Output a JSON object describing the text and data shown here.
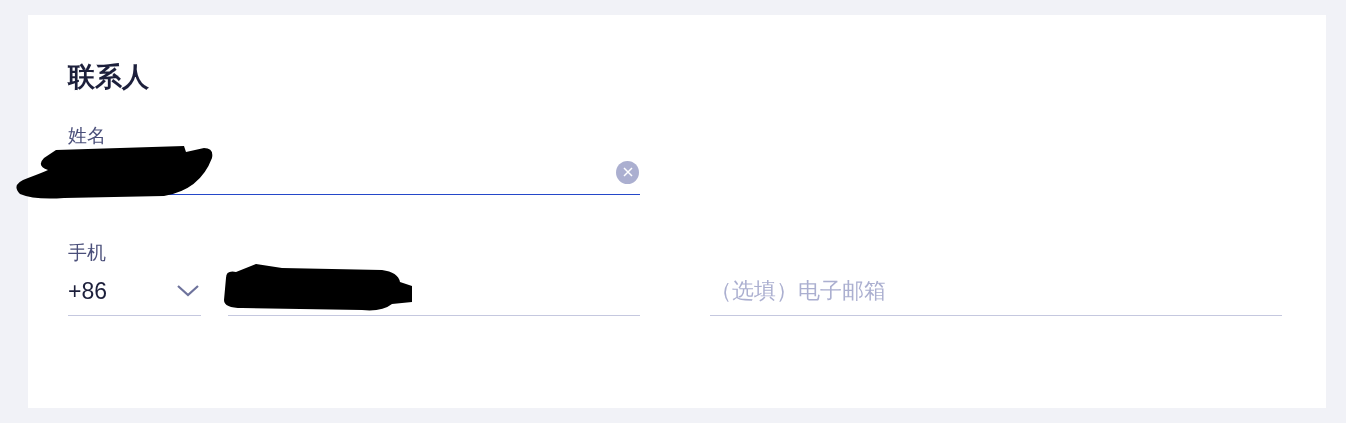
{
  "section_title": "联系人",
  "name_field": {
    "label": "姓名",
    "focused": true,
    "redacted": true,
    "clearable": true
  },
  "phone_field": {
    "label": "手机",
    "country_code": "+86",
    "redacted": true,
    "focused": false
  },
  "email_field": {
    "placeholder": "（选填）电子邮箱",
    "focused": false
  }
}
